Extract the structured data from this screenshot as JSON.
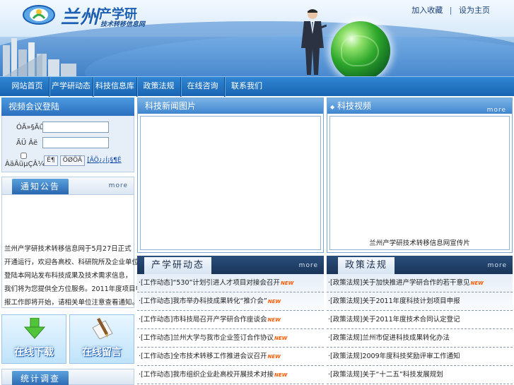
{
  "header": {
    "logo_main": "兰州",
    "logo_secondary": "产学研",
    "logo_sub": "技术转移信息网",
    "links": [
      {
        "label": "加入收藏"
      },
      {
        "label": "设为主页"
      }
    ]
  },
  "nav": {
    "items": [
      {
        "label": "网站首页"
      },
      {
        "label": "产学研动态"
      },
      {
        "label": "科技信息库"
      },
      {
        "label": "政策法规"
      },
      {
        "label": "在线咨询"
      },
      {
        "label": "联系我们"
      }
    ]
  },
  "login": {
    "title": "视频会议登陆",
    "username_label": "ÓÃ»§Ãû",
    "password_label": "ÃÜ  Âë",
    "remember_label": "ÀäÂüµÇÂ¼",
    "login_button": "È¶",
    "reset_button": "ÖØÖÃ",
    "register_link": "[ÃÖ¿¿Í¡§¶É"
  },
  "notice": {
    "title": "通知公告",
    "more": "more",
    "lines": [
      "兰州产学研技术转移信息网于5月27日正式",
      "开通运行，欢迎各高校、科研院所及企业单位",
      "登陆本网站发布科技成果及技术需求信息，",
      "我们将为您提供全方位服务。2011年度项目申",
      "报工作即将开始，请相关单位注意查看通知。"
    ]
  },
  "quick_links": {
    "download": "在线下载",
    "message": "在线留言"
  },
  "survey": {
    "title": "统计调查"
  },
  "tech_news_photos": {
    "title": "科技新闻图片"
  },
  "tech_video": {
    "title": "科技视频",
    "more": "more",
    "caption": "兰州产学研技术转移信息网宣传片"
  },
  "iur_news": {
    "title": "产学研动态",
    "more": "more",
    "items": [
      {
        "tag": "[工作动态]",
        "text": "“530”计划引进人才项目对接会召开",
        "is_new": true
      },
      {
        "tag": "[工作动态]",
        "text": "我市举办科技成果转化“推介会”",
        "is_new": true
      },
      {
        "tag": "[工作动态]",
        "text": "市科技局召开产学研合作座谈会",
        "is_new": true
      },
      {
        "tag": "[工作动态]",
        "text": "兰州大学与我市企业签订合作协议",
        "is_new": true
      },
      {
        "tag": "[工作动态]",
        "text": "全市技术转移工作推进会议召开",
        "is_new": true
      },
      {
        "tag": "[工作动态]",
        "text": "我市组织企业赴高校开展技术对接",
        "is_new": true
      }
    ]
  },
  "policy": {
    "title": "政策法规",
    "more": "more",
    "items": [
      {
        "tag": "[政策法规]",
        "text": "关于加快推进产学研合作的若干意见",
        "is_new": true
      },
      {
        "tag": "[政策法规]",
        "text": "关于2011年度科技计划项目申报",
        "is_new": false
      },
      {
        "tag": "[政策法规]",
        "text": "关于2011年度技术合同认定登记",
        "is_new": false
      },
      {
        "tag": "[政策法规]",
        "text": "兰州市促进科技成果转化办法",
        "is_new": false
      },
      {
        "tag": "[政策法规]",
        "text": "2009年度科技奖励评审工作通知",
        "is_new": false
      },
      {
        "tag": "[政策法规]",
        "text": "关于“十二五”科技发展规划",
        "is_new": false
      }
    ]
  },
  "new_badge": "NEW"
}
